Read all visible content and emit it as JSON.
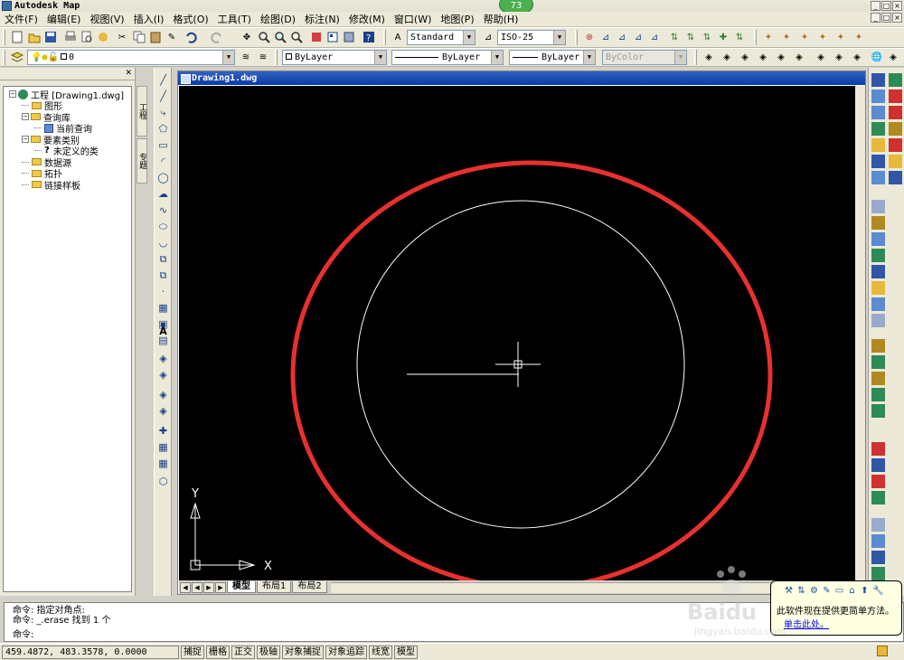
{
  "app": {
    "title": "Autodesk Map"
  },
  "notification_badge": "73",
  "menu": [
    "文件(F)",
    "编辑(E)",
    "视图(V)",
    "插入(I)",
    "格式(O)",
    "工具(T)",
    "绘图(D)",
    "标注(N)",
    "修改(M)",
    "窗口(W)",
    "地图(P)",
    "帮助(H)"
  ],
  "toolbar": {
    "text_style": "Standard",
    "dim_style": "ISO-25",
    "layer": "0",
    "color": "ByLayer",
    "linetype": "ByLayer",
    "lineweight": "ByLayer",
    "plotstyle": "ByColor"
  },
  "workspace": {
    "title_icons": [
      "close-icon"
    ],
    "tree": [
      {
        "label": "工程 [Drawing1.dwg]",
        "level": 0,
        "icon": "globe"
      },
      {
        "label": "图形",
        "level": 1,
        "icon": "folder"
      },
      {
        "label": "查询库",
        "level": 1,
        "icon": "folder"
      },
      {
        "label": "当前查询",
        "level": 2,
        "icon": "query"
      },
      {
        "label": "要素类别",
        "level": 1,
        "icon": "folder"
      },
      {
        "label": "未定义的类",
        "level": 2,
        "icon": "question"
      },
      {
        "label": "数据源",
        "level": 1,
        "icon": "folder"
      },
      {
        "label": "拓扑",
        "level": 1,
        "icon": "folder"
      },
      {
        "label": "链接样板",
        "level": 1,
        "icon": "folder"
      }
    ],
    "vtabs": [
      "工程",
      "专题"
    ]
  },
  "drawing": {
    "title": "Drawing1.dwg",
    "axis_x": "X",
    "axis_y": "Y",
    "tabs": [
      "模型",
      "布局1",
      "布局2"
    ]
  },
  "command": {
    "lines": [
      "命令: 指定对角点:",
      "命令: _.erase 找到 1 个",
      "命令:"
    ]
  },
  "status": {
    "coords": "459.4872, 483.3578, 0.0000",
    "buttons": [
      "捕捉",
      "栅格",
      "正交",
      "极轴",
      "对象捕捉",
      "对象追踪",
      "线宽",
      "模型"
    ]
  },
  "balloon": {
    "message": "此软件现在提供更简单方法。",
    "link": "单击此处。"
  },
  "watermark": {
    "brand": "Baidu",
    "url": "jingyan.baidu.com"
  },
  "colors": {
    "accent": "#e8312f",
    "canvas": "#000000",
    "title_gradient": "#0b3aa6"
  }
}
